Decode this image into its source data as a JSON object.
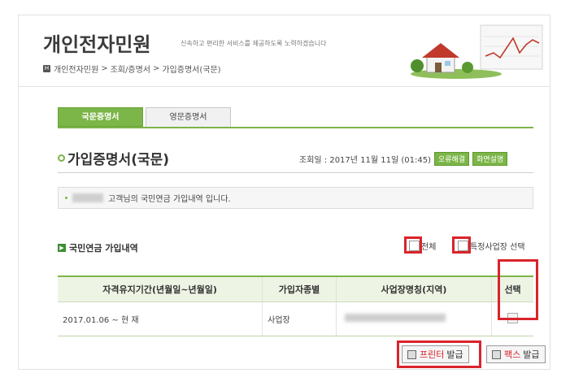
{
  "header": {
    "site_title": "개인전자민원",
    "tagline": "신속하고 편리한 서비스를 제공하도록 노력하겠습니다",
    "breadcrumb": [
      "개인전자민원",
      "조회/증명서",
      "가입증명서(국문)"
    ]
  },
  "tabs": [
    {
      "label": "국문증명서",
      "active": true
    },
    {
      "label": "영문증명서",
      "active": false
    }
  ],
  "section": {
    "title": "가입증명서(국문)",
    "lookup_label": "조회일 : 2017년 11월 11일 (01:45)",
    "btn_error": "오류해결",
    "btn_help": "화면설명"
  },
  "notice": {
    "text": "고객님의 국민연금 가입내역 입니다."
  },
  "list": {
    "title": "국민연금 가입내역",
    "check_all_label": "전체",
    "check_specific_label": "특정사업장 선택"
  },
  "table": {
    "columns": [
      "자격유지기간(년월일~년월일)",
      "가입자종별",
      "사업장명칭(지역)",
      "선택"
    ],
    "rows": [
      {
        "period": "2017.01.06 ~ 현 재",
        "type": "사업장"
      }
    ]
  },
  "buttons": {
    "print_icon_label": "프린터",
    "print_label": "발급",
    "fax_icon_label": "팩스",
    "fax_label": "발급"
  },
  "colors": {
    "accent": "#7cb548",
    "highlight": "#d9242b"
  }
}
